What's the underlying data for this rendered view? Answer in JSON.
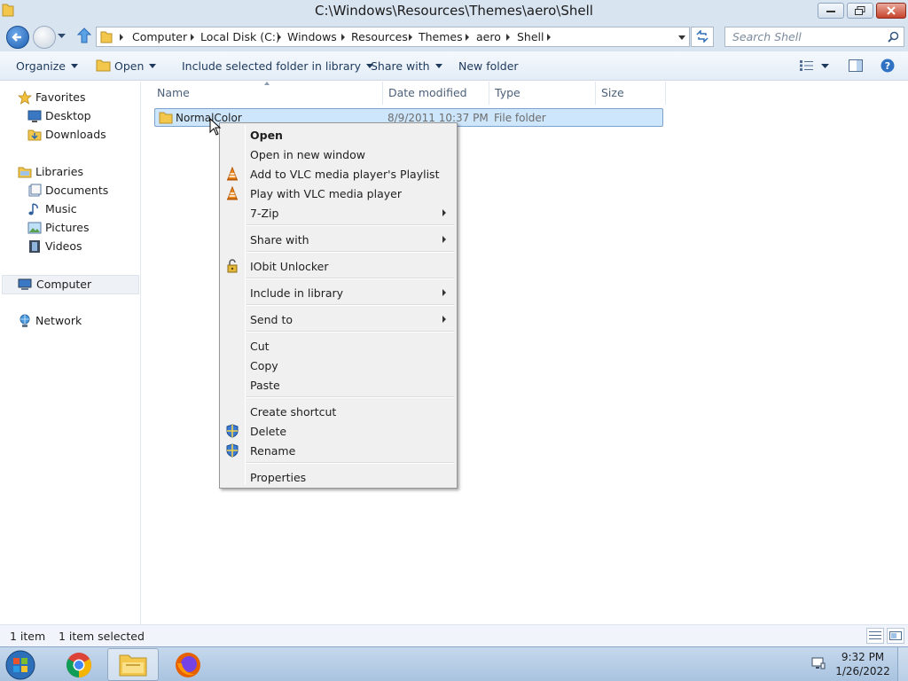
{
  "window": {
    "title": "C:\\Windows\\Resources\\Themes\\aero\\Shell"
  },
  "address_bar": {
    "breadcrumbs": [
      "Computer",
      "Local Disk (C:)",
      "Windows",
      "Resources",
      "Themes",
      "aero",
      "Shell"
    ]
  },
  "search": {
    "placeholder": "Search Shell"
  },
  "toolbar": {
    "organize": "Organize",
    "open": "Open",
    "include_library": "Include selected folder in library",
    "share_with": "Share with",
    "new_folder": "New folder"
  },
  "nav": {
    "favorites": "Favorites",
    "desktop": "Desktop",
    "downloads": "Downloads",
    "libraries": "Libraries",
    "documents": "Documents",
    "music": "Music",
    "pictures": "Pictures",
    "videos": "Videos",
    "computer": "Computer",
    "network": "Network"
  },
  "columns": {
    "name": "Name",
    "date_modified": "Date modified",
    "type": "Type",
    "size": "Size"
  },
  "files": [
    {
      "name": "NormalColor",
      "date_modified": "8/9/2011 10:37 PM",
      "type": "File folder",
      "size": ""
    }
  ],
  "context_menu": {
    "open": "Open",
    "open_new_window": "Open in new window",
    "vlc_add_playlist": "Add to VLC media player's Playlist",
    "vlc_play": "Play with VLC media player",
    "seven_zip": "7-Zip",
    "share_with": "Share with",
    "iobit_unlocker": "IObit Unlocker",
    "include_in_library": "Include in library",
    "send_to": "Send to",
    "cut": "Cut",
    "copy": "Copy",
    "paste": "Paste",
    "create_shortcut": "Create shortcut",
    "delete": "Delete",
    "rename": "Rename",
    "properties": "Properties"
  },
  "status": {
    "item_count": "1 item",
    "selected_count": "1 item selected"
  },
  "taskbar": {
    "apps": [
      "chrome-icon",
      "file-explorer-icon",
      "firefox-icon"
    ],
    "time": "9:32 PM",
    "date": "1/26/2022"
  },
  "colors": {
    "selection_bg": "#cde6fb",
    "selection_border": "#7da2ce",
    "chrome_bg": "#d9e4f1",
    "taskbar_bg": "#b7cde6"
  }
}
